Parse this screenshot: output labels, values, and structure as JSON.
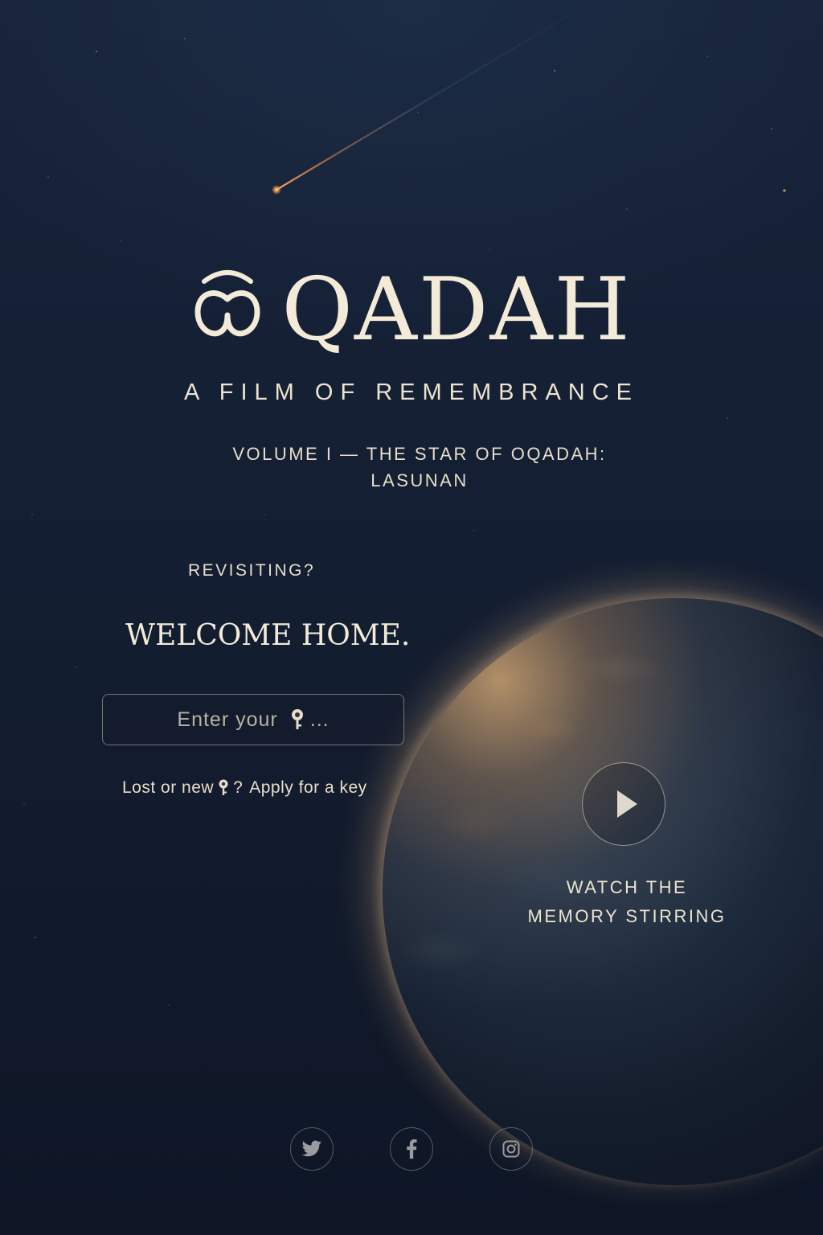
{
  "brand": {
    "logo_text": "QADAH",
    "tagline": "A FILM OF REMEMBRANCE"
  },
  "volume": {
    "line1": "VOLUME I — THE STAR OF OQADAH:",
    "line2": "LASUNAN"
  },
  "login": {
    "revisiting": "REVISITING?",
    "welcome": "WELCOME HOME.",
    "input_placeholder_before": "Enter your",
    "input_placeholder_after": "...",
    "input_placeholder_icon": "key-icon",
    "input_value": "",
    "lost_prefix": "Lost or new",
    "lost_suffix": "?",
    "apply_link": "Apply for a key"
  },
  "video": {
    "play_icon": "play-icon",
    "label_line1": "WATCH THE",
    "label_line2": "MEMORY STIRRING"
  },
  "social": [
    {
      "icon": "twitter-icon"
    },
    {
      "icon": "facebook-icon"
    },
    {
      "icon": "instagram-icon"
    }
  ],
  "colors": {
    "background": "#141f33",
    "text": "#ede3cf",
    "glow": "#d9a66b",
    "comet": "#ff9a3c"
  }
}
